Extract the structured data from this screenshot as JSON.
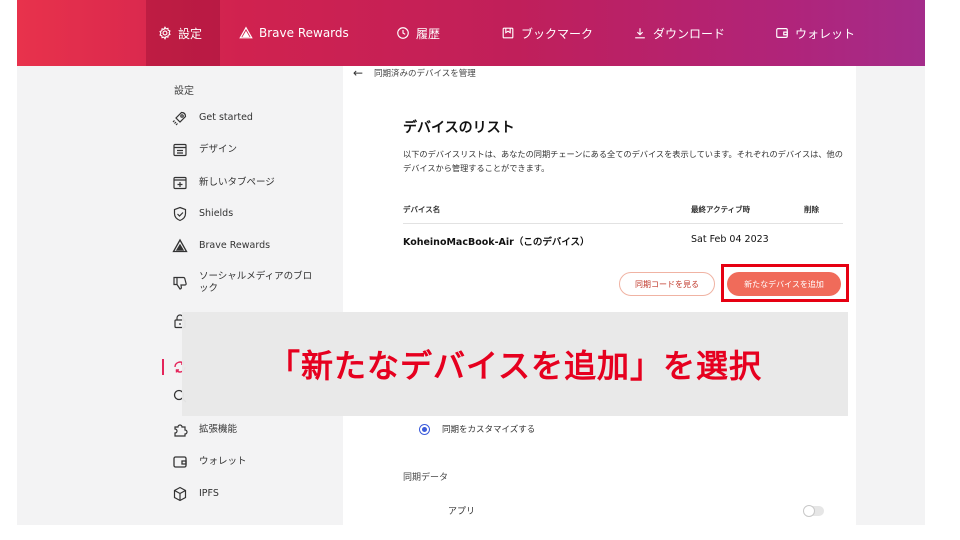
{
  "topbar": {
    "tabs": [
      {
        "label": "設定",
        "icon": "gear-icon"
      },
      {
        "label": "Brave Rewards",
        "icon": "triangle-icon"
      },
      {
        "label": "履歴",
        "icon": "history-icon"
      },
      {
        "label": "ブックマーク",
        "icon": "bookmark-icon"
      },
      {
        "label": "ダウンロード",
        "icon": "download-icon"
      },
      {
        "label": "ウォレット",
        "icon": "wallet-icon"
      }
    ]
  },
  "sidebar": {
    "heading": "設定",
    "items": [
      {
        "label": "Get started",
        "icon": "rocket-icon"
      },
      {
        "label": "デザイン",
        "icon": "layout-icon"
      },
      {
        "label": "新しいタブページ",
        "icon": "new-tab-icon"
      },
      {
        "label": "Shields",
        "icon": "shield-icon"
      },
      {
        "label": "Brave Rewards",
        "icon": "triangle-icon"
      },
      {
        "label": "ソーシャルメディアのブロック",
        "icon": "thumbs-down-icon"
      },
      {
        "label": "",
        "icon": "lock-icon"
      },
      {
        "label": "",
        "icon": "sync-icon"
      },
      {
        "label": "",
        "icon": "search-icon"
      },
      {
        "label": "拡張機能",
        "icon": "puzzle-icon"
      },
      {
        "label": "ウォレット",
        "icon": "wallet-icon"
      },
      {
        "label": "IPFS",
        "icon": "cube-icon"
      }
    ]
  },
  "main": {
    "back_glyph": "←",
    "breadcrumb": "同期済みのデバイスを管理",
    "list_title": "デバイスのリスト",
    "description": "以下のデバイスリストは、あなたの同期チェーンにある全てのデバイスを表示しています。それぞれのデバイスは、他のデバイスから管理することができます。",
    "table": {
      "headers": [
        "デバイス名",
        "最終アクティブ時",
        "削除"
      ],
      "rows": [
        {
          "device": "KoheinoMacBook-Air（このデバイス）",
          "last_active": "Sat Feb 04 2023"
        }
      ]
    },
    "view_code_button": "同期コードを見る",
    "add_device_button": "新たなデバイスを追加",
    "customize_sync_label": "同期をカスタマイズする",
    "sync_data_heading": "同期データ",
    "app_label": "アプリ"
  },
  "overlay": {
    "caption": "「新たなデバイスを追加」を選択",
    "highlight_color": "#e60012"
  },
  "colors": {
    "accent": "#e4245a",
    "button_primary": "#f06b5a",
    "radio": "#3b5bdb"
  }
}
